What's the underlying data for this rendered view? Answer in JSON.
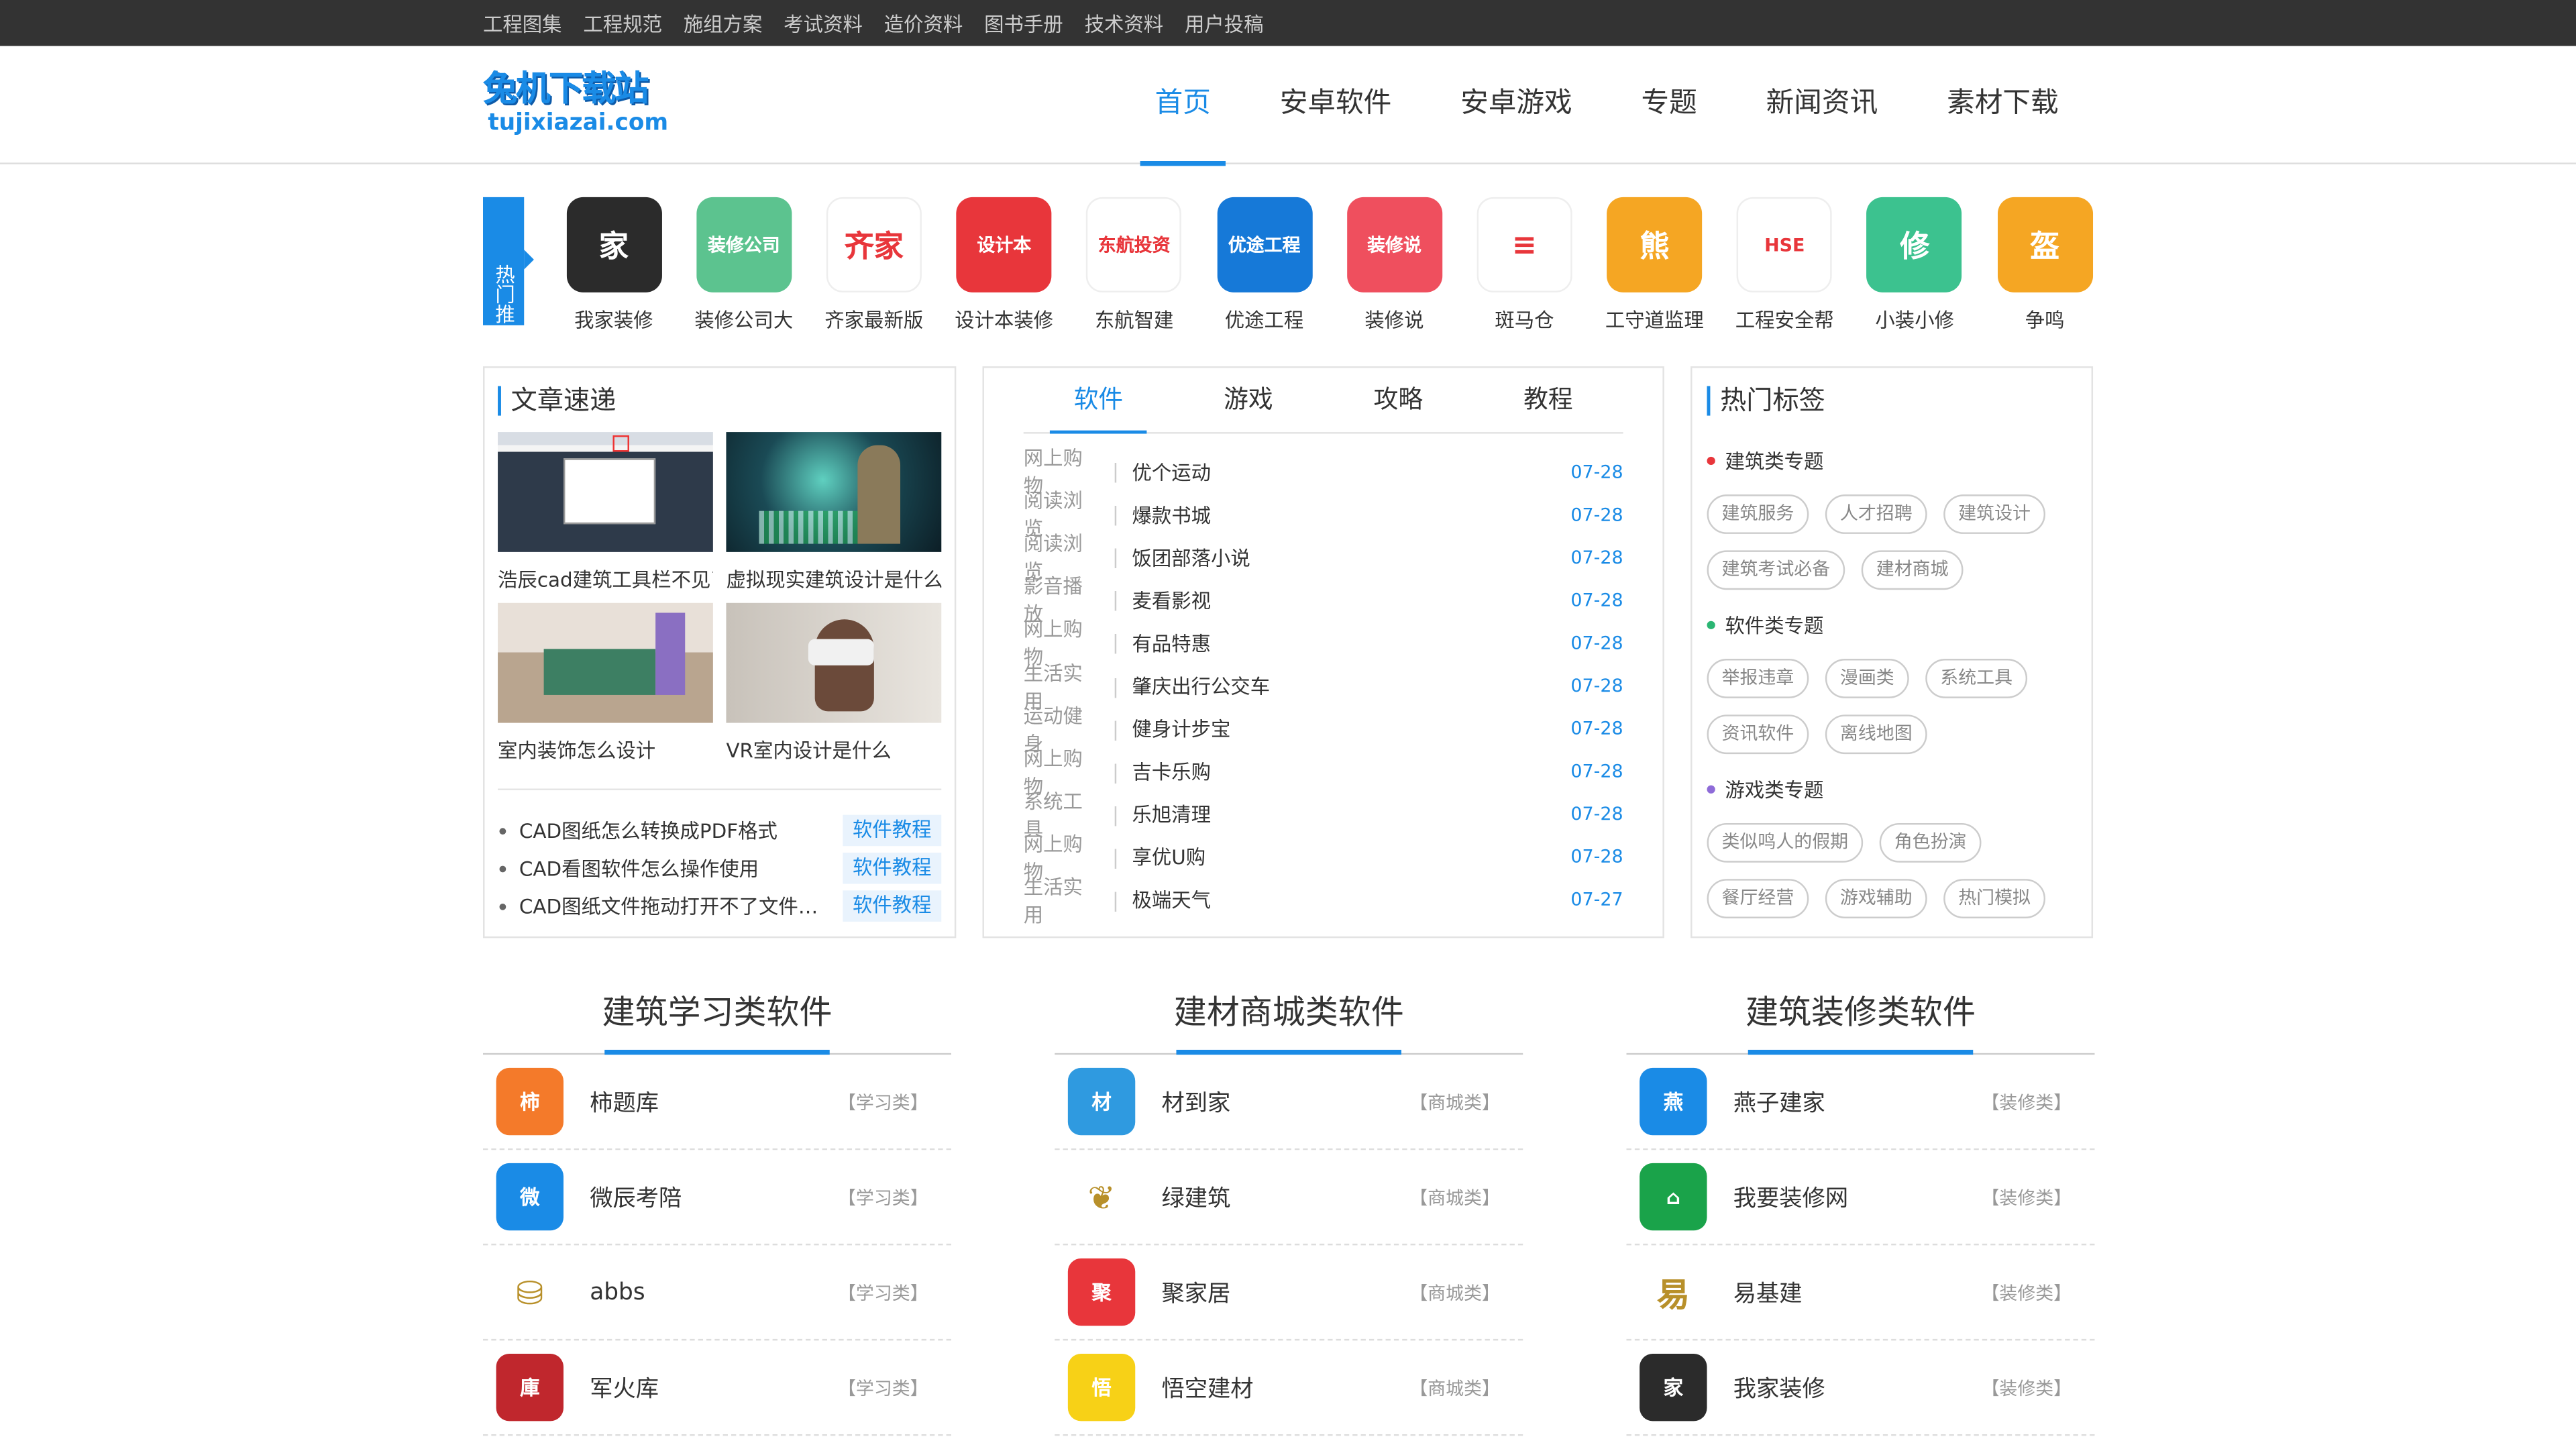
{
  "topbar": [
    "工程图集",
    "工程规范",
    "施组方案",
    "考试资料",
    "造价资料",
    "图书手册",
    "技术资料",
    "用户投稿"
  ],
  "logo": {
    "line1": "兔机下载站",
    "line2": "tujixiazai.com"
  },
  "nav": [
    "首页",
    "安卓软件",
    "安卓游戏",
    "专题",
    "新闻资讯",
    "素材下载"
  ],
  "hot": {
    "tag": "热门推荐",
    "apps": [
      {
        "name": "我家装修",
        "color": "#2b2b2b",
        "glyph": "家"
      },
      {
        "name": "装修公司大",
        "color": "#5cc38f",
        "glyph": "装修公司"
      },
      {
        "name": "齐家最新版",
        "color": "#ffffff",
        "glyph": "齐家"
      },
      {
        "name": "设计本装修",
        "color": "#e8363b",
        "glyph": "设计本"
      },
      {
        "name": "东航智建",
        "color": "#ffffff",
        "glyph": "东航投资"
      },
      {
        "name": "优途工程",
        "color": "#1679d8",
        "glyph": "优途工程"
      },
      {
        "name": "装修说",
        "color": "#ef4f5e",
        "glyph": "装修说"
      },
      {
        "name": "斑马仓",
        "color": "#ffffff",
        "glyph": "≡"
      },
      {
        "name": "工守道监理",
        "color": "#f5a623",
        "glyph": "熊"
      },
      {
        "name": "工程安全帮",
        "color": "#ffffff",
        "glyph": "HSE"
      },
      {
        "name": "小装小修",
        "color": "#3cc28f",
        "glyph": "修"
      },
      {
        "name": "争鸣",
        "color": "#f5a623",
        "glyph": "盔"
      }
    ]
  },
  "news": {
    "title": "文章速递",
    "thumbs": [
      {
        "caption": "浩辰cad建筑工具栏不见了怎么办"
      },
      {
        "caption": "虚拟现实建筑设计是什么"
      },
      {
        "caption": "室内装饰怎么设计"
      },
      {
        "caption": "VR室内设计是什么"
      }
    ],
    "list": [
      {
        "title": "CAD图纸怎么转换成PDF格式",
        "cat": "软件教程"
      },
      {
        "title": "CAD看图软件怎么操作使用",
        "cat": "软件教程"
      },
      {
        "title": "CAD图纸文件拖动打开不了文件如何解决",
        "cat": "软件教程"
      }
    ]
  },
  "tabs": {
    "items": [
      "软件",
      "游戏",
      "攻略",
      "教程"
    ],
    "rows": [
      {
        "cat": "网上购物",
        "name": "优个运动",
        "date": "07-28"
      },
      {
        "cat": "阅读浏览",
        "name": "爆款书城",
        "date": "07-28"
      },
      {
        "cat": "阅读浏览",
        "name": "饭团部落小说",
        "date": "07-28"
      },
      {
        "cat": "影音播放",
        "name": "麦看影视",
        "date": "07-28"
      },
      {
        "cat": "网上购物",
        "name": "有品特惠",
        "date": "07-28"
      },
      {
        "cat": "生活实用",
        "name": "肇庆出行公交车",
        "date": "07-28"
      },
      {
        "cat": "运动健身",
        "name": "健身计步宝",
        "date": "07-28"
      },
      {
        "cat": "网上购物",
        "name": "吉卡乐购",
        "date": "07-28"
      },
      {
        "cat": "系统工具",
        "name": "乐旭清理",
        "date": "07-28"
      },
      {
        "cat": "网上购物",
        "name": "享优U购",
        "date": "07-28"
      },
      {
        "cat": "生活实用",
        "name": "极端天气",
        "date": "07-27"
      }
    ]
  },
  "tags": {
    "title": "热门标签",
    "groups": [
      {
        "title": "建筑类专题",
        "color": "#e8363b",
        "chips": [
          "建筑服务",
          "人才招聘",
          "建筑设计",
          "建筑考试必备",
          "建材商城"
        ]
      },
      {
        "title": "软件类专题",
        "color": "#2bb673",
        "chips": [
          "举报违章",
          "漫画类",
          "系统工具",
          "资讯软件",
          "离线地图"
        ]
      },
      {
        "title": "游戏类专题",
        "color": "#8e6bd8",
        "chips": [
          "类似鸣人的假期",
          "角色扮演",
          "餐厅经营",
          "游戏辅助",
          "热门模拟"
        ]
      }
    ]
  },
  "sections": [
    {
      "title": "建筑学习类软件",
      "items": [
        {
          "name": "柿题库",
          "type": "【学习类】",
          "color": "#f47a2a",
          "glyph": "柿"
        },
        {
          "name": "微辰考陪",
          "type": "【学习类】",
          "color": "#1a8be6",
          "glyph": "微"
        },
        {
          "name": "abbs",
          "type": "【学习类】",
          "color": "#ffffff",
          "glyph": "⛁"
        },
        {
          "name": "军火库",
          "type": "【学习类】",
          "color": "#c0272d",
          "glyph": "庫"
        }
      ]
    },
    {
      "title": "建材商城类软件",
      "items": [
        {
          "name": "材到家",
          "type": "【商城类】",
          "color": "#2f9ae0",
          "glyph": "材"
        },
        {
          "name": "绿建筑",
          "type": "【商城类】",
          "color": "#ffffff",
          "glyph": "❦"
        },
        {
          "name": "聚家居",
          "type": "【商城类】",
          "color": "#e8363b",
          "glyph": "聚"
        },
        {
          "name": "悟空建材",
          "type": "【商城类】",
          "color": "#f7d117",
          "glyph": "悟"
        }
      ]
    },
    {
      "title": "建筑装修类软件",
      "items": [
        {
          "name": "燕子建家",
          "type": "【装修类】",
          "color": "#1a8be6",
          "glyph": "燕"
        },
        {
          "name": "我要装修网",
          "type": "【装修类】",
          "color": "#1aa34a",
          "glyph": "⌂"
        },
        {
          "name": "易基建",
          "type": "【装修类】",
          "color": "#ffffff",
          "glyph": "易"
        },
        {
          "name": "我家装修",
          "type": "【装修类】",
          "color": "#2b2b2b",
          "glyph": "家"
        }
      ]
    }
  ]
}
